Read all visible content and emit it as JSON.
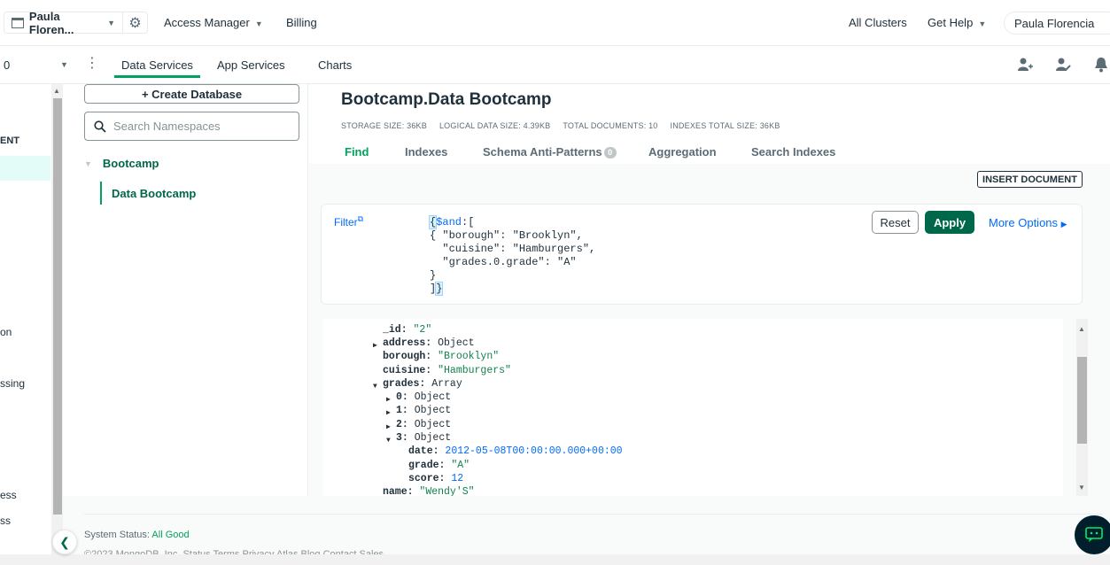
{
  "topbar": {
    "org_name": "Paula Floren...",
    "access_manager": "Access Manager",
    "billing": "Billing",
    "all_clusters": "All Clusters",
    "get_help": "Get Help",
    "user_name": "Paula Florencia"
  },
  "navbar": {
    "project_name": "0",
    "tabs": [
      {
        "label": "Data Services",
        "active": true
      },
      {
        "label": "App Services",
        "active": false
      },
      {
        "label": "Charts",
        "active": false
      }
    ],
    "icons": [
      "invite-user-icon",
      "activity-feed-icon",
      "bell-icon"
    ]
  },
  "left_sidebar": {
    "items": [
      "ENT",
      "on",
      "ssing",
      "ess",
      "ss"
    ]
  },
  "namespace_panel": {
    "create_database": "+ Create Database",
    "search_placeholder": "Search Namespaces",
    "database": "Bootcamp",
    "collection": "Data Bootcamp"
  },
  "collection": {
    "title": "Bootcamp.Data Bootcamp",
    "stats": [
      "STORAGE SIZE: 36KB",
      "LOGICAL DATA SIZE: 4.39KB",
      "TOTAL DOCUMENTS: 10",
      "INDEXES TOTAL SIZE: 36KB"
    ],
    "tabs": [
      "Find",
      "Indexes",
      "Schema Anti-Patterns",
      "Aggregation",
      "Search Indexes"
    ],
    "schema_badge": "0",
    "insert_document": "INSERT DOCUMENT"
  },
  "filter": {
    "label": "Filter",
    "line1_open": "{",
    "line1_key": "$and",
    "line1_rest": ":[",
    "line2": "{ \"borough\": \"Brooklyn\",",
    "line3": "  \"cuisine\": \"Hamburgers\",",
    "line4": "  \"grades.0.grade\": \"A\"",
    "line5": "}",
    "line6_a": "]",
    "line6_b": "}",
    "reset": "Reset",
    "apply": "Apply",
    "more_options": "More Options"
  },
  "document": {
    "id_key": "_id:",
    "id_val": "\"2\"",
    "address_key": "address:",
    "address_val": "Object",
    "borough_key": "borough:",
    "borough_val": "\"Brooklyn\"",
    "cuisine_key": "cuisine:",
    "cuisine_val": "\"Hamburgers\"",
    "grades_key": "grades:",
    "grades_val": "Array",
    "g0_key": "0:",
    "g0_val": "Object",
    "g1_key": "1:",
    "g1_val": "Object",
    "g2_key": "2:",
    "g2_val": "Object",
    "g3_key": "3:",
    "g3_val": "Object",
    "date_key": "date:",
    "date_val": "2012-05-08T00:00:00.000+00:00",
    "grade_key": "grade:",
    "grade_val": "\"A\"",
    "score_key": "score:",
    "score_val": "12",
    "name_key": "name:",
    "name_val": "\"Wendy'S\""
  },
  "footer": {
    "system_status_label": "System Status: ",
    "system_status_value": "All Good",
    "copyright": "©2023 MongoDB, Inc.   Status   Terms   Privacy   Atlas Blog   Contact Sales"
  },
  "colors": {
    "brand_green": "#00684a",
    "accent_green": "#00a35c",
    "link_blue": "#016bf8"
  }
}
